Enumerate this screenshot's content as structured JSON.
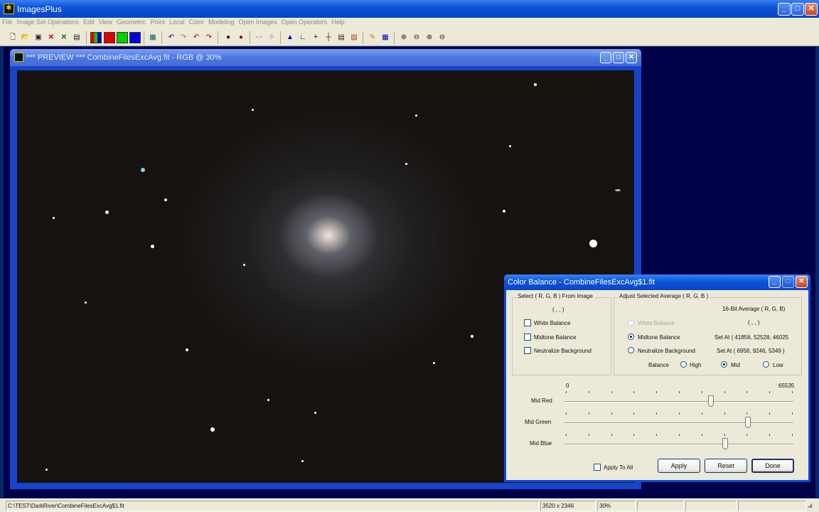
{
  "app": {
    "title": "ImagesPlus",
    "menu": [
      "File",
      "Image Set Operations",
      "Edit",
      "View",
      "Geometric",
      "Point",
      "Local",
      "Color",
      "Modeling",
      "Open Images",
      "Open Operators",
      "Help"
    ]
  },
  "preview": {
    "title": "*** PREVIEW *** CombineFilesExcAvg.fit - RGB @ 30%"
  },
  "color_balance": {
    "title": "Color Balance - CombineFilesExcAvg$1.fit",
    "select_group": {
      "label": "Select ( R, G, B ) From Image",
      "value": "( , , )",
      "options": [
        "White Balance",
        "Midtone Balance",
        "Neutralize Background"
      ]
    },
    "adjust_group": {
      "label": "Adjust Selected Average ( R, G, B )",
      "avg_label": "16-Bit Average ( R, G, B)",
      "avg_value": "( , , )",
      "options": [
        "White Balance",
        "Midtone Balance",
        "Neutralize Background"
      ],
      "selected_option": "Midtone Balance",
      "set_midtone": "Set At ( 41856, 52528, 46025",
      "set_background": "Set At ( 6958, 9246, 5349 )",
      "balance_label": "Balance",
      "balance_options": [
        "High",
        "Mid",
        "Low"
      ],
      "balance_selected": "Mid"
    },
    "scale_min": "0",
    "scale_max": "65535",
    "sliders": [
      {
        "label": "Mid Red",
        "value": 41856
      },
      {
        "label": "Mid Green",
        "value": 52528
      },
      {
        "label": "Mid Blue",
        "value": 46025
      }
    ],
    "apply_to_all": "Apply To All",
    "buttons": {
      "apply": "Apply",
      "reset": "Reset",
      "done": "Done"
    }
  },
  "status": {
    "path": "C:\\TEST\\DarkRiver\\CombineFilesExcAvg$1.fit",
    "dimensions": "3520 x 2346",
    "zoom": "30%"
  }
}
